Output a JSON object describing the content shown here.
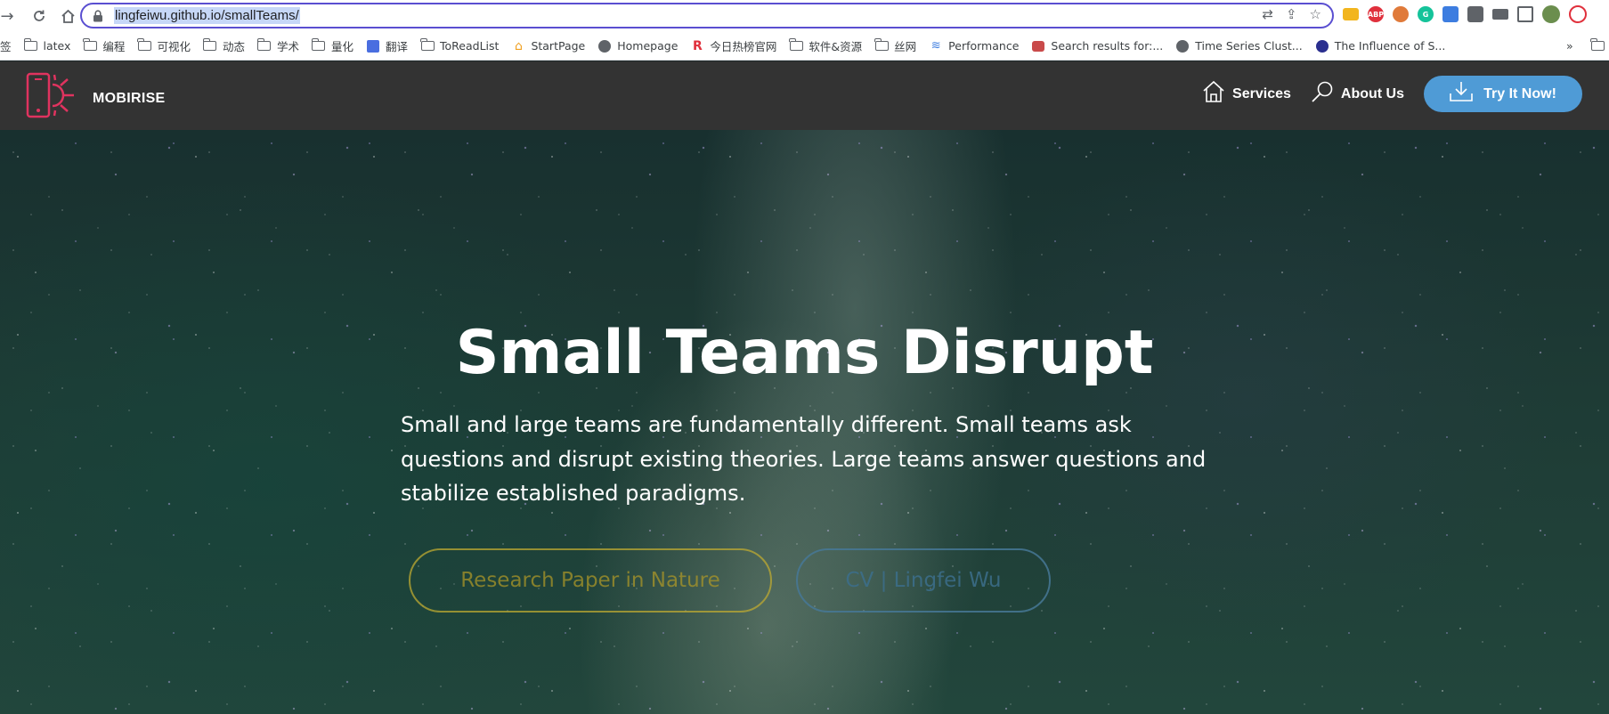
{
  "browser": {
    "url": "lingfeiwu.github.io/smallTeams/",
    "nav_icons": [
      "back-icon",
      "reload-icon",
      "home-icon"
    ],
    "extensions": [
      {
        "name": "folder-extension",
        "label": "",
        "color": "#f2b51d"
      },
      {
        "name": "adblock-plus",
        "label": "ABP",
        "color": "#e0303c"
      },
      {
        "name": "rss-extension",
        "label": "",
        "color": "#e07a3a"
      },
      {
        "name": "grammarly",
        "label": "G",
        "color": "#15c39a"
      },
      {
        "name": "feather-extension",
        "label": "",
        "color": "#3d7de0"
      },
      {
        "name": "puzzle-extensions",
        "label": "",
        "color": "#5f6368"
      },
      {
        "name": "reading-list",
        "label": "",
        "color": "#5f6368"
      },
      {
        "name": "side-panel",
        "label": "",
        "color": "#5f6368"
      },
      {
        "name": "profile-avatar",
        "label": "",
        "color": "#6b8e4e"
      }
    ]
  },
  "bookmarks": [
    {
      "label": "签",
      "icon": "none"
    },
    {
      "label": "latex",
      "icon": "folder-icon"
    },
    {
      "label": "编程",
      "icon": "folder-icon"
    },
    {
      "label": "可视化",
      "icon": "folder-icon"
    },
    {
      "label": "动态",
      "icon": "folder-icon"
    },
    {
      "label": "学术",
      "icon": "folder-icon"
    },
    {
      "label": "量化",
      "icon": "folder-icon"
    },
    {
      "label": "翻译",
      "icon": "translate-icon"
    },
    {
      "label": "ToReadList",
      "icon": "folder-icon"
    },
    {
      "label": "StartPage",
      "icon": "house-icon"
    },
    {
      "label": "Homepage",
      "icon": "globe-icon"
    },
    {
      "label": "今日热榜官网",
      "icon": "r-logo-icon"
    },
    {
      "label": "软件&资源",
      "icon": "folder-icon"
    },
    {
      "label": "丝网",
      "icon": "folder-icon"
    },
    {
      "label": "Performance",
      "icon": "performance-icon"
    },
    {
      "label": "Search results for:...",
      "icon": "search-site-icon"
    },
    {
      "label": "Time Series Clust...",
      "icon": "globe-icon"
    },
    {
      "label": "The Influence of S...",
      "icon": "s-logo-icon"
    }
  ],
  "bookmarks_overflow": "»",
  "site": {
    "brand": "MOBIRISE",
    "nav": [
      {
        "label": "Services",
        "icon": "home-outline-icon"
      },
      {
        "label": "About Us",
        "icon": "search-outline-icon"
      }
    ],
    "cta": "Try It Now!",
    "accent": "#4f9bd6",
    "logo_color": "#e0335f"
  },
  "hero": {
    "title": "Small Teams Disrupt",
    "text": "Small and large teams are fundamentally different. Small teams ask questions and disrupt existing theories. Large teams answer questions and stabilize established paradigms.",
    "button_paper": "Research Paper in Nature",
    "button_cv": "CV | Lingfei Wu"
  }
}
